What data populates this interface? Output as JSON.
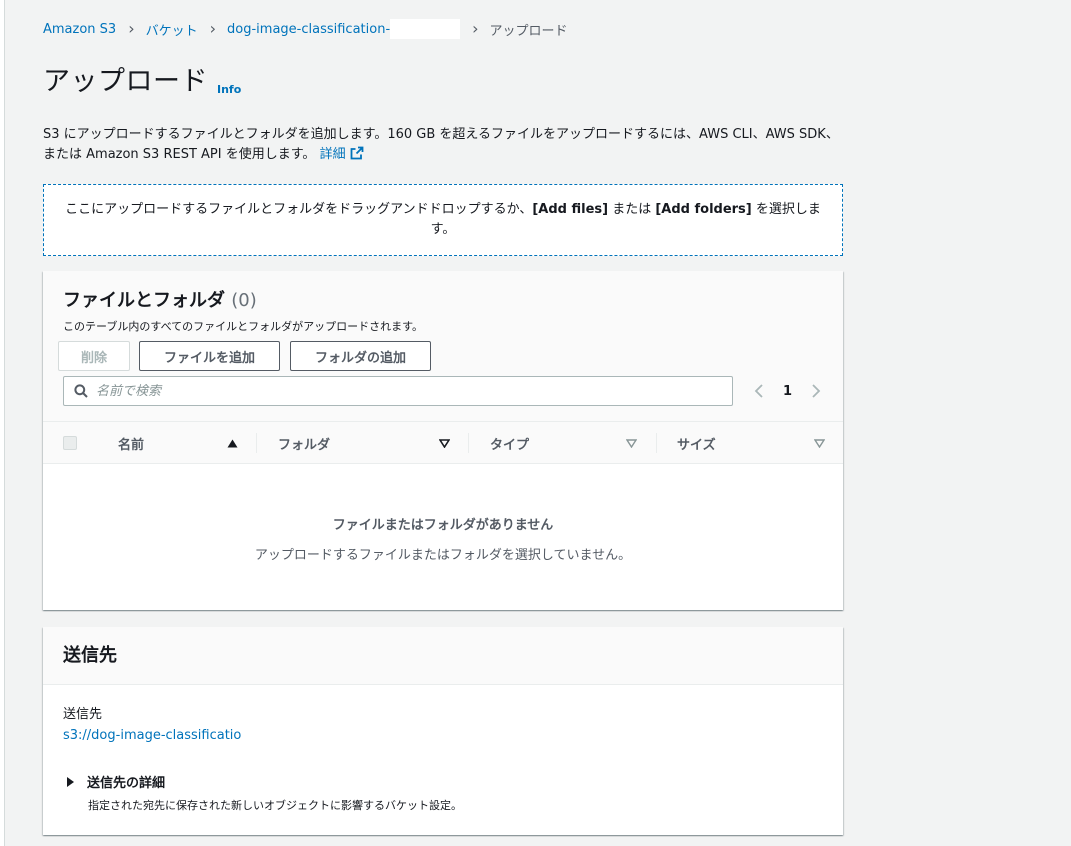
{
  "breadcrumb": {
    "items": [
      "Amazon S3",
      "バケット",
      "dog-image-classification-"
    ],
    "current": "アップロード",
    "separator": ">"
  },
  "header": {
    "title": "アップロード",
    "info_label": "Info"
  },
  "description": {
    "text": "S3 にアップロードするファイルとフォルダを追加します。160 GB を超えるファイルをアップロードするには、AWS CLI、AWS SDK、または Amazon S3 REST API を使用します。",
    "link_label": "詳細"
  },
  "dropzone": {
    "text_before": "ここにアップロードするファイルとフォルダをドラッグアンドドロップするか、",
    "add_files": "[Add files]",
    "text_middle": " または ",
    "add_folders": "[Add folders]",
    "text_after": " を選択します。"
  },
  "files_panel": {
    "title": "ファイルとフォルダ",
    "count": "(0)",
    "subtitle": "このテーブル内のすべてのファイルとフォルダがアップロードされます。",
    "delete_label": "削除",
    "add_files_label": "ファイルを追加",
    "add_folder_label": "フォルダの追加",
    "search_placeholder": "名前で検索",
    "page_number": "1",
    "columns": [
      "名前",
      "フォルダ",
      "タイプ",
      "サイズ"
    ],
    "empty_title": "ファイルまたはフォルダがありません",
    "empty_subtitle": "アップロードするファイルまたはフォルダを選択していません。"
  },
  "destination": {
    "title": "送信先",
    "label": "送信先",
    "url": "s3://dog-image-classificatio",
    "details_label": "送信先の詳細",
    "details_subtitle": "指定された宛先に保存された新しいオブジェクトに影響するバケット設定。"
  },
  "colors": {
    "link": "#0073bb",
    "text": "#16191f",
    "muted": "#545b64",
    "background": "#f2f3f3"
  }
}
